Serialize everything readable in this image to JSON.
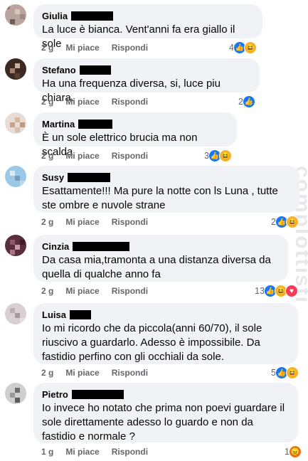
{
  "watermark": "complottisti",
  "comments": [
    {
      "name": "Giulia",
      "text": "La luce è bianca. Vent'anni fa era giallo il sole",
      "time": "2 g",
      "like": "Mi piace",
      "reply": "Rispondi",
      "reaction_count": "4",
      "reactions": [
        "like-icon",
        "haha-icon"
      ]
    },
    {
      "name": "Stefano",
      "text": "Ha una frequenza diversa, si, luce piu chiara.",
      "time": "2 g",
      "like": "Mi piace",
      "reply": "Rispondi",
      "reaction_count": "2",
      "reactions": [
        "like-icon"
      ]
    },
    {
      "name": "Martina",
      "text": "È un sole elettrico brucia ma non scalda",
      "time": "2 g",
      "like": "Mi piace",
      "reply": "Rispondi",
      "reaction_count": "3",
      "reactions": [
        "like-icon",
        "haha-icon"
      ]
    },
    {
      "name": "Susy",
      "text": "Esattamente!!! Ma pure la notte con ls Luna , tutte ste ombre e nuvole strane",
      "time": "2 g",
      "like": "Mi piace",
      "reply": "Rispondi",
      "reaction_count": "2",
      "reactions": [
        "like-icon",
        "haha-icon"
      ]
    },
    {
      "name": "Cinzia",
      "text": "Da casa mia,tramonta a una distanza diversa da quella di qualche anno fa",
      "time": "2 g",
      "like": "Mi piace",
      "reply": "Rispondi",
      "reaction_count": "13",
      "reactions": [
        "like-icon",
        "haha-icon",
        "love-icon"
      ]
    },
    {
      "name": "Luisa",
      "text": "Io mi ricordo che da piccola(anni 60/70), il sole riuscivo a guardarlo. Adesso è impossibile. Da fastidio perfino con gli occhiali da sole.",
      "time": "2 g",
      "like": "Mi piace",
      "reply": "Rispondi",
      "reaction_count": "5",
      "reactions": [
        "like-icon",
        "haha-icon"
      ]
    },
    {
      "name": "Pietro",
      "text": "Io invece ho notato che prima non poevi guardare il sole direttamente adesso lo guardo e non da fastidio e normale ?",
      "time": "1 g",
      "like": "Mi piace",
      "reply": "Rispondi",
      "reaction_count": "1",
      "reactions": [
        "angry-icon"
      ]
    }
  ],
  "colors": {
    "like": "#1877f2",
    "haha": "#f7b125",
    "love": "#f33e58",
    "angry": "#e9710f",
    "bubble": "#f0f2f5",
    "meta": "#65676b"
  }
}
